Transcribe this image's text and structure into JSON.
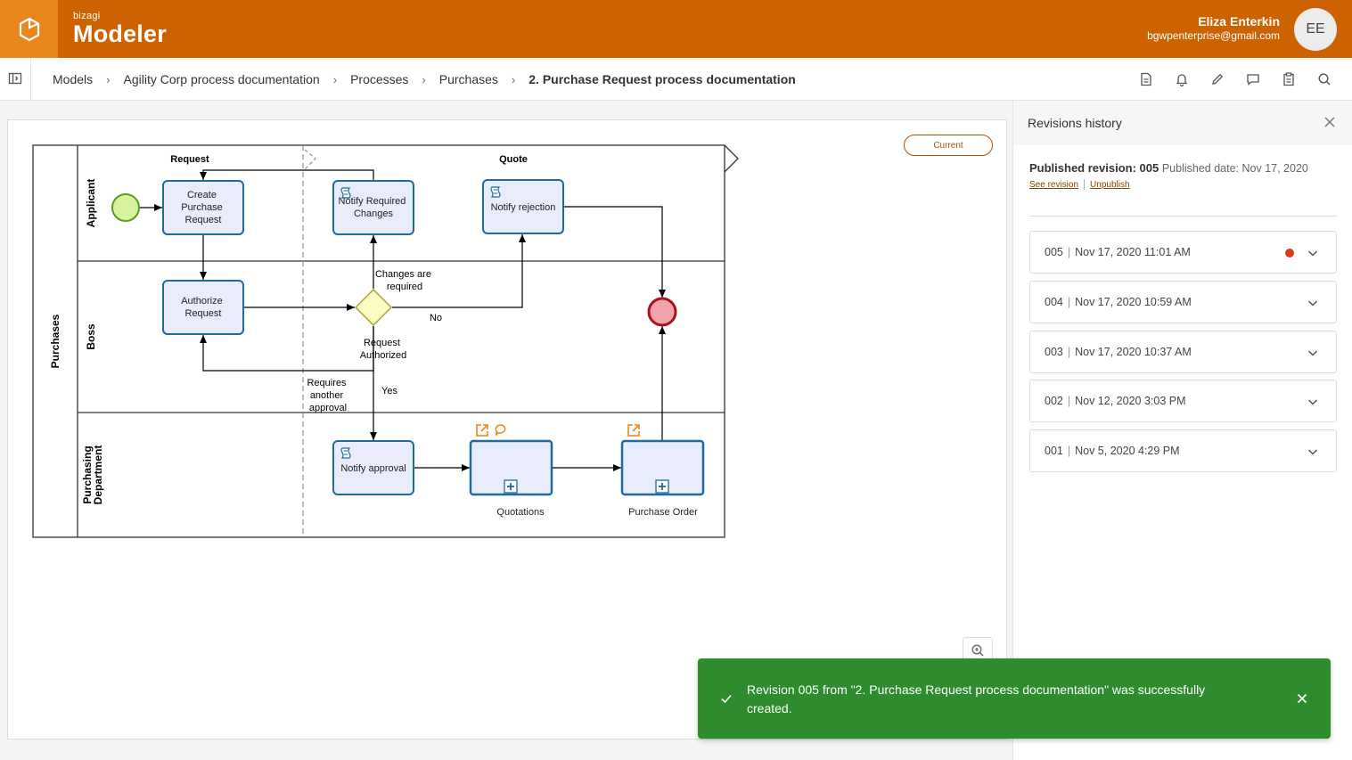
{
  "app": {
    "brand_small": "bizagi",
    "brand_name": "Modeler"
  },
  "user": {
    "name": "Eliza Enterkin",
    "email": "bgwpenterprise@gmail.com",
    "initials": "EE"
  },
  "breadcrumb": [
    "Models",
    "Agility Corp process documentation",
    "Processes",
    "Purchases",
    "2. Purchase Request process documentation"
  ],
  "toolbar_icons": [
    "document-icon",
    "bell-icon",
    "pencil-icon",
    "comment-icon",
    "clipboard-icon",
    "search-icon"
  ],
  "canvas": {
    "current_label": "Current"
  },
  "diagram": {
    "pool": "Purchases",
    "lanes": [
      "Applicant",
      "Boss",
      "Purchasing\nDepartment"
    ],
    "phases": [
      "Request",
      "Quote"
    ],
    "tasks": {
      "create": [
        "Create",
        "Purchase",
        "Request"
      ],
      "notify_changes": [
        "Notify Required",
        "Changes"
      ],
      "notify_rejection": "Notify rejection",
      "authorize": [
        "Authorize",
        "Request"
      ],
      "notify_approval": "Notify approval",
      "quotations": "Quotations",
      "purchase_order": "Purchase Order"
    },
    "flow_labels": {
      "changes_required": [
        "Changes are",
        "required"
      ],
      "no": "No",
      "authorized": [
        "Request",
        "Authorized"
      ],
      "another_approval": [
        "Requires",
        "another",
        "approval"
      ],
      "yes": "Yes"
    }
  },
  "revisions_panel": {
    "title": "Revisions history",
    "published_label": "Published revision: 005",
    "published_date": "Published date: Nov 17, 2020",
    "see_revision": "See revision",
    "unpublish": "Unpublish",
    "items": [
      {
        "id": "005",
        "date": "Nov 17, 2020 11:01 AM",
        "status_color": "#d83a1c"
      },
      {
        "id": "004",
        "date": "Nov 17, 2020 10:59 AM"
      },
      {
        "id": "003",
        "date": "Nov 17, 2020 10:37 AM"
      },
      {
        "id": "002",
        "date": "Nov 12, 2020 3:03 PM"
      },
      {
        "id": "001",
        "date": "Nov 5, 2020 4:29 PM"
      }
    ]
  },
  "toast": {
    "message": "Revision 005 from \"2. Purchase Request process documentation\" was successfully created."
  },
  "colors": {
    "header": "#cc6200",
    "logo_bg": "#e9861c",
    "toast": "#2e8b2e",
    "task_fill": "#e8ecfb",
    "task_stroke": "#1e6b9e"
  }
}
